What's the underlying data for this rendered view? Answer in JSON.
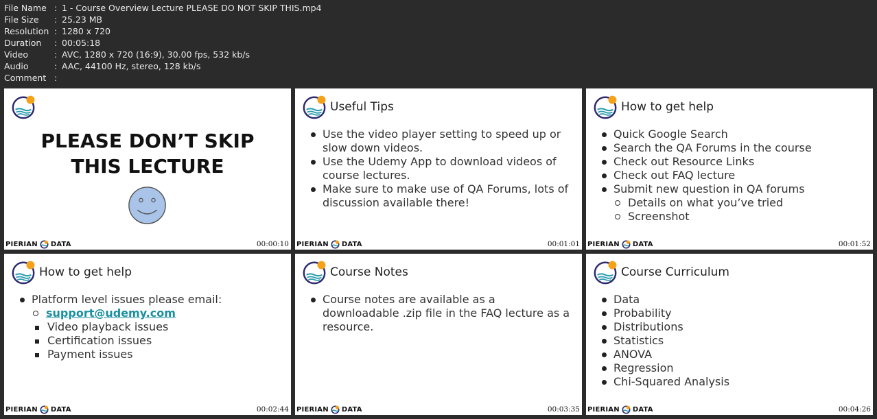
{
  "metadata": [
    {
      "key": "File Name",
      "value": "1 - Course Overview Lecture PLEASE DO NOT SKIP THIS.mp4"
    },
    {
      "key": "File Size",
      "value": "25.23 MB"
    },
    {
      "key": "Resolution",
      "value": "1280 x 720"
    },
    {
      "key": "Duration",
      "value": "00:05:18"
    },
    {
      "key": "Video",
      "value": "AVC, 1280 x 720 (16:9), 30.00 fps, 532 kb/s"
    },
    {
      "key": "Audio",
      "value": "AAC, 44100 Hz, stereo, 128 kb/s"
    },
    {
      "key": "Comment",
      "value": ""
    }
  ],
  "separator": ":",
  "brand": {
    "left": "PIERIAN",
    "right": "DATA"
  },
  "colors": {
    "background": "#2b2b2b",
    "logo_navy": "#2d2a6e",
    "logo_orange": "#f5a21b",
    "logo_teal": "#2a9db0",
    "link": "#1a8fa0",
    "smiley": "#a9c4e8"
  },
  "thumbnails": [
    {
      "title": "",
      "big_title_lines": [
        "PLEASE DON’T SKIP",
        "THIS LECTURE"
      ],
      "timestamp": "00:00:10",
      "items": []
    },
    {
      "title": "Useful Tips",
      "timestamp": "00:01:01",
      "items": [
        {
          "text": "Use the video player setting to speed up or slow down videos."
        },
        {
          "text": "Use the Udemy App to download videos of course lectures."
        },
        {
          "text": "Make sure to make use of QA Forums, lots of discussion available there!"
        }
      ]
    },
    {
      "title": "How to get help",
      "timestamp": "00:01:52",
      "items": [
        {
          "text": "Quick Google Search"
        },
        {
          "text": "Search the QA Forums in the course"
        },
        {
          "text": "Check out Resource Links"
        },
        {
          "text": "Check out FAQ lecture"
        },
        {
          "text": "Submit new question in QA forums"
        },
        {
          "text": "Details on what you’ve tried"
        },
        {
          "text": "Screenshot"
        }
      ]
    },
    {
      "title": "How to get help",
      "timestamp": "00:02:44",
      "items": [
        {
          "text": "Platform level issues please email:"
        },
        {
          "text": "support@udemy.com"
        },
        {
          "text": "Video playback issues"
        },
        {
          "text": "Certification issues"
        },
        {
          "text": "Payment issues"
        }
      ]
    },
    {
      "title": "Course Notes",
      "timestamp": "00:03:35",
      "items": [
        {
          "text": "Course notes are available as a downloadable .zip file in the FAQ lecture as a resource."
        }
      ]
    },
    {
      "title": "Course Curriculum",
      "timestamp": "00:04:26",
      "items": [
        {
          "text": "Data"
        },
        {
          "text": "Probability"
        },
        {
          "text": "Distributions"
        },
        {
          "text": "Statistics"
        },
        {
          "text": "ANOVA"
        },
        {
          "text": "Regression"
        },
        {
          "text": "Chi-Squared Analysis"
        }
      ]
    }
  ]
}
